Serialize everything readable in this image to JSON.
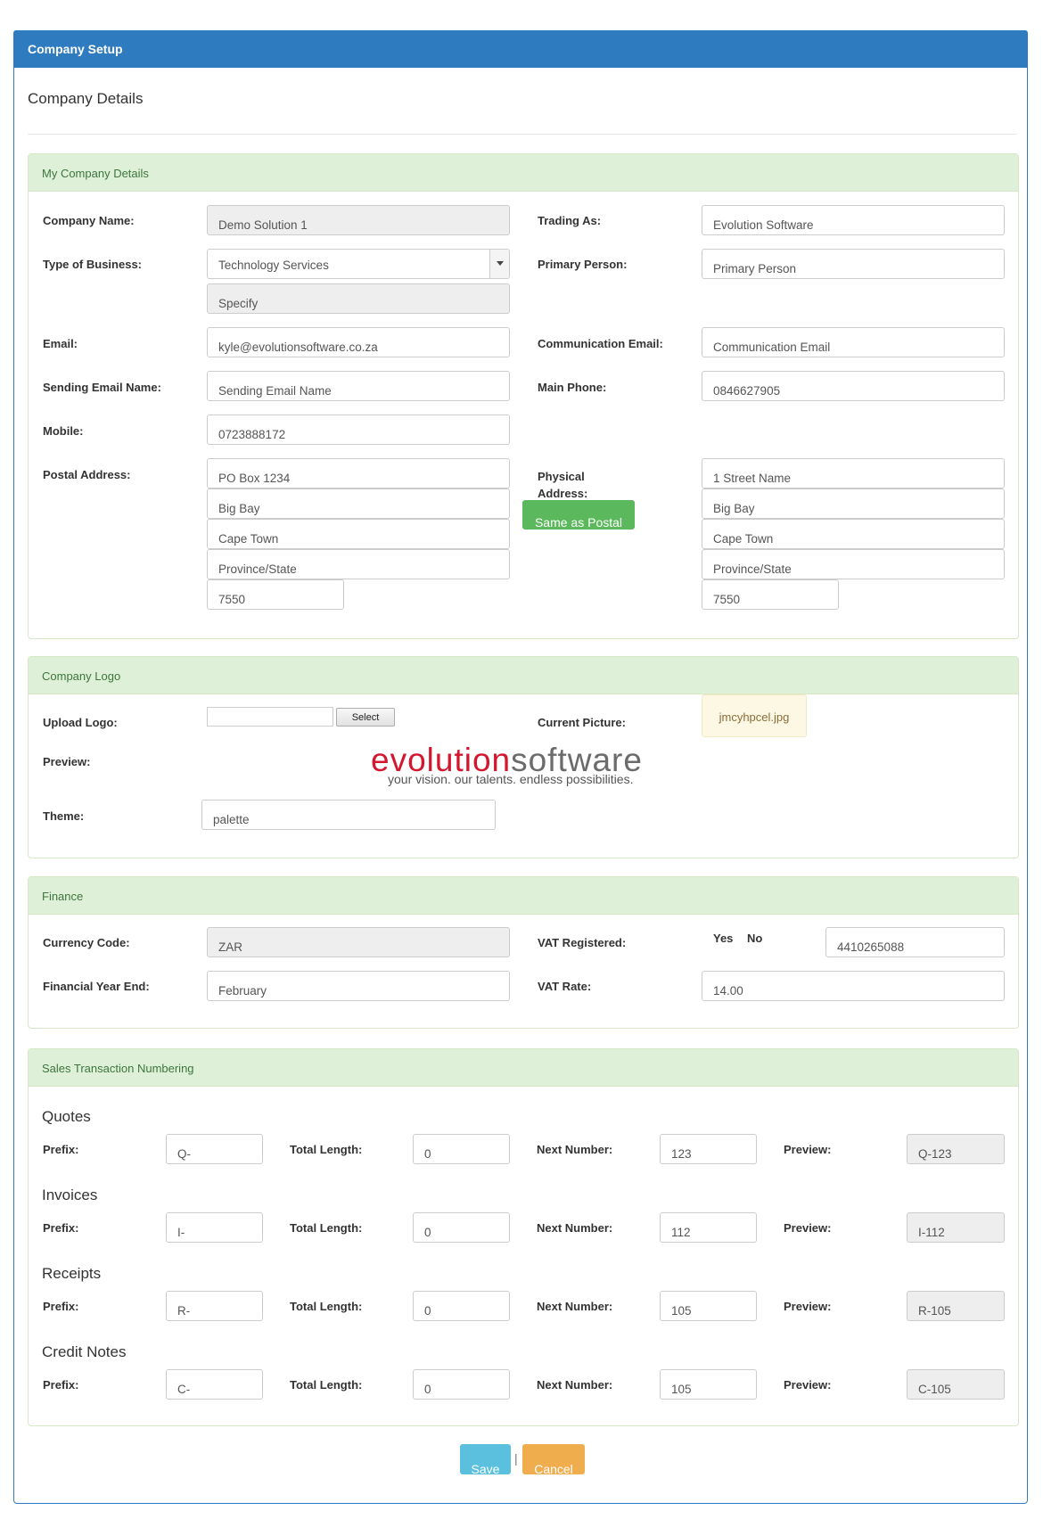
{
  "header": {
    "title": "Company Setup"
  },
  "page": {
    "title": "Company Details"
  },
  "company_details": {
    "heading": "My Company Details",
    "company_name_label": "Company Name:",
    "company_name": "Demo Solution 1",
    "trading_as_label": "Trading As:",
    "trading_as": "Evolution Software",
    "type_of_business_label": "Type of Business:",
    "type_of_business": "Technology Services",
    "specify_placeholder": "Specify",
    "primary_person_label": "Primary Person:",
    "primary_person_placeholder": "Primary Person",
    "email_label": "Email:",
    "email": "kyle@evolutionsoftware.co.za",
    "communication_email_label": "Communication Email:",
    "communication_email_placeholder": "Communication Email",
    "sending_email_name_label": "Sending Email Name:",
    "sending_email_name_placeholder": "Sending Email Name",
    "main_phone_label": "Main Phone:",
    "main_phone": "0846627905",
    "mobile_label": "Mobile:",
    "mobile": "0723888172",
    "postal_address_label": "Postal Address:",
    "postal": [
      "PO Box 1234",
      "Big Bay",
      "Cape Town",
      "Province/State",
      "7550"
    ],
    "physical_address_label": "Physical Address:",
    "physical": [
      "1 Street Name",
      "Big Bay",
      "Cape Town",
      "Province/State",
      "7550"
    ],
    "same_as_postal_label": "Same as Postal"
  },
  "company_logo": {
    "heading": "Company Logo",
    "upload_logo_label": "Upload Logo:",
    "select_button": "Select",
    "current_picture_label": "Current Picture:",
    "current_picture": "jmcyhpcel.jpg",
    "preview_label": "Preview:",
    "logo_word1": "evolution",
    "logo_word2": "software",
    "logo_tagline": "your vision.  our talents.  endless possibilities.",
    "theme_label": "Theme:",
    "theme": "palette"
  },
  "finance": {
    "heading": "Finance",
    "currency_code_label": "Currency Code:",
    "currency_code": "ZAR",
    "vat_registered_label": "VAT Registered:",
    "yes_label": "Yes",
    "no_label": "No",
    "vat_number": "4410265088",
    "financial_year_end_label": "Financial Year End:",
    "financial_year_end": "February",
    "vat_rate_label": "VAT Rate:",
    "vat_rate": "14.00"
  },
  "sales_numbering": {
    "heading": "Sales Transaction Numbering",
    "prefix_label": "Prefix:",
    "total_length_label": "Total Length:",
    "next_number_label": "Next Number:",
    "preview_label": "Preview:",
    "groups": [
      {
        "title": "Quotes",
        "prefix": "Q-",
        "total_length": "0",
        "next_number": "123",
        "preview": "Q-123"
      },
      {
        "title": "Invoices",
        "prefix": "I-",
        "total_length": "0",
        "next_number": "112",
        "preview": "I-112"
      },
      {
        "title": "Receipts",
        "prefix": "R-",
        "total_length": "0",
        "next_number": "105",
        "preview": "R-105"
      },
      {
        "title": "Credit Notes",
        "prefix": "C-",
        "total_length": "0",
        "next_number": "105",
        "preview": "C-105"
      }
    ]
  },
  "actions": {
    "save": "Save",
    "separator": "|",
    "cancel": "Cancel"
  }
}
